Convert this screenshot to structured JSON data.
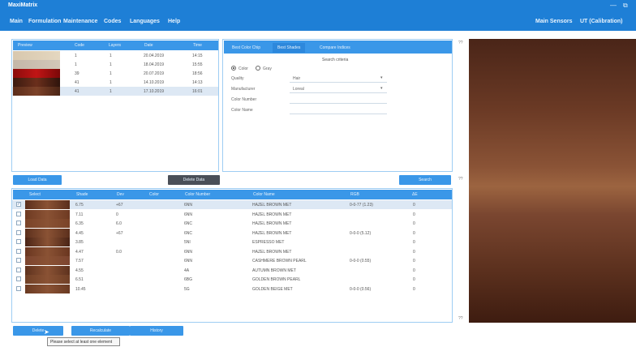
{
  "app": {
    "title": "MaxiMatrix"
  },
  "menu": {
    "items": [
      "Main",
      "Formulation",
      "Maintenance",
      "Codes",
      "Languages",
      "Help"
    ],
    "right": [
      "Main Sensors",
      "UT (Calibration)"
    ]
  },
  "history": {
    "columns": [
      "Preview",
      "Code",
      "Layers",
      "Date",
      "Time"
    ],
    "rows": [
      {
        "code": "1",
        "layers": "1",
        "date": "20.04.2019",
        "time": "14:15"
      },
      {
        "code": "1",
        "layers": "1",
        "date": "18.04.2019",
        "time": "15:55"
      },
      {
        "code": "39",
        "layers": "1",
        "date": "20.07.2019",
        "time": "18:56"
      },
      {
        "code": "41",
        "layers": "1",
        "date": "14.10.2019",
        "time": "14:13"
      },
      {
        "code": "41",
        "layers": "1",
        "date": "17.10.2019",
        "time": "16:01"
      }
    ]
  },
  "search": {
    "tabs": [
      "Best Color Chip",
      "Best Shades",
      "Compare Indices"
    ],
    "title": "Search criteria",
    "radio_color": "Color",
    "radio_gray": "Gray",
    "quality_label": "Quality",
    "quality_value": "Hair",
    "manufacturer_label": "Manufacturer",
    "manufacturer_value": "Loreal",
    "color_number_label": "Color Number",
    "color_name_label": "Color Name"
  },
  "buttons": {
    "load_data": "Load Data",
    "delete_data": "Delete Data",
    "search": "Search",
    "delete": "Delete",
    "recalculate": "Recalculate",
    "history": "History"
  },
  "results": {
    "columns": [
      "Select",
      "Shade",
      "Dev",
      "Color",
      "Color Number",
      "Color Name",
      "RGB",
      "ΔE"
    ],
    "rows": [
      {
        "checked": true,
        "shade": "6.75",
        "dev": "+67",
        "num": "6NN",
        "name": "HAZEL BROWN MET",
        "rgb": "0-0-77 (1.23)",
        "de": "0"
      },
      {
        "checked": false,
        "shade": "7.11",
        "dev": "0",
        "num": "6NN",
        "name": "HAZEL BROWN MET",
        "rgb": "",
        "de": "0"
      },
      {
        "checked": false,
        "shade": "6.35",
        "dev": "6.0",
        "num": "6NC",
        "name": "HAZEL BROWN MET",
        "rgb": "",
        "de": "0"
      },
      {
        "checked": false,
        "shade": "4.45",
        "dev": "+67",
        "num": "6NC",
        "name": "HAZEL BROWN MET",
        "rgb": "0-0-0 (5.12)",
        "de": "0"
      },
      {
        "checked": false,
        "shade": "3.85",
        "dev": "",
        "num": "5NI",
        "name": "ESPRESSO MET",
        "rgb": "",
        "de": "0"
      },
      {
        "checked": false,
        "shade": "4.47",
        "dev": "0.0",
        "num": "6NN",
        "name": "HAZEL BROWN MET",
        "rgb": "",
        "de": "0"
      },
      {
        "checked": false,
        "shade": "7.57",
        "dev": "",
        "num": "6NN",
        "name": "CASHMERE BROWN PEARL",
        "rgb": "0-0-0 (0.55)",
        "de": "0"
      },
      {
        "checked": false,
        "shade": "4.55",
        "dev": "",
        "num": "4A",
        "name": "AUTUMN BROWN MET",
        "rgb": "",
        "de": "0"
      },
      {
        "checked": false,
        "shade": "6.51",
        "dev": "",
        "num": "6BG",
        "name": "GOLDEN BROWN PEARL",
        "rgb": "",
        "de": "0"
      },
      {
        "checked": false,
        "shade": "10.45",
        "dev": "",
        "num": "5G",
        "name": "GOLDEN BEIGE MET",
        "rgb": "0-0-0 (0.56)",
        "de": "0"
      }
    ]
  },
  "scroll_markers": [
    "??",
    "??",
    "??"
  ],
  "tooltip": "Please select at least one element"
}
